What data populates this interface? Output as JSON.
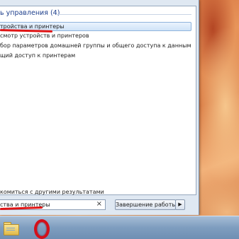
{
  "start_menu": {
    "group_header": "ь управления (4)",
    "results": [
      {
        "label": "тройства и принтеры",
        "selected": true
      },
      {
        "label": "смотр устройств и принтеров",
        "selected": false
      },
      {
        "label": "бор параметров домашней группы и общего доступа к данным",
        "selected": false
      },
      {
        "label": "щий доступ к принтерам",
        "selected": false
      }
    ],
    "see_more": "комиться с другими результатами",
    "search": {
      "value": "ства и принтеры",
      "clear_icon": "×"
    },
    "shutdown_label": "Завершение работы",
    "shutdown_arrow": "▶"
  },
  "taskbar": {
    "items": [
      {
        "name": "explorer",
        "icon": "folder-icon"
      },
      {
        "name": "opera",
        "icon": "opera-icon"
      }
    ]
  },
  "colors": {
    "highlight_underline": "#e01414",
    "group_header": "#1e3f8c",
    "selection": "#cfe3f8"
  }
}
